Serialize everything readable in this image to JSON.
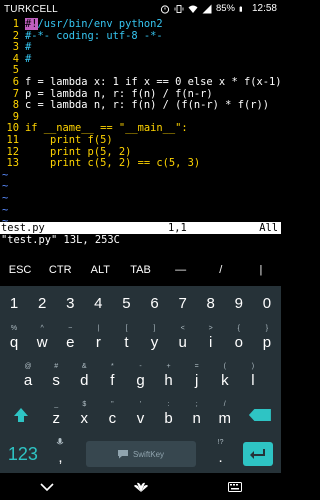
{
  "status": {
    "carrier": "TURKCELL",
    "battery": "85%",
    "time": "12:58"
  },
  "editor": {
    "lines": [
      {
        "n": "1",
        "text": "/usr/bin/env python2"
      },
      {
        "n": "2",
        "text": "#-*- coding: utf-8 -*-"
      },
      {
        "n": "3",
        "text": "#"
      },
      {
        "n": "4",
        "text": "#"
      },
      {
        "n": "5",
        "text": ""
      },
      {
        "n": "6",
        "text": "f = lambda x: 1 if x == 0 else x * f(x-1)"
      },
      {
        "n": "7",
        "text": "p = lambda n, r: f(n) / f(n-r)"
      },
      {
        "n": "8",
        "text": "c = lambda n, r: f(n) / (f(n-r) * f(r))"
      },
      {
        "n": "9",
        "text": ""
      },
      {
        "n": "10",
        "text": "if __name__ == \"__main__\":"
      },
      {
        "n": "11",
        "text": "    print f(5)"
      },
      {
        "n": "12",
        "text": "    print p(5, 2)"
      },
      {
        "n": "13",
        "text": "    print c(5, 2) == c(5, 3)"
      }
    ],
    "tilde_count": 6
  },
  "modeline": {
    "filename": "test.py",
    "position": "1,1",
    "scope": "All"
  },
  "cmdline": "\"test.py\" 13L, 253C",
  "extra_keys": [
    "ESC",
    "CTR",
    "ALT",
    "TAB",
    "—",
    "/",
    "|"
  ],
  "keyboard": {
    "numbers": [
      "1",
      "2",
      "3",
      "4",
      "5",
      "6",
      "7",
      "8",
      "9",
      "0"
    ],
    "row1": [
      {
        "sub": "%",
        "key": "q"
      },
      {
        "sub": "^",
        "key": "w"
      },
      {
        "sub": "~",
        "key": "e"
      },
      {
        "sub": "|",
        "key": "r"
      },
      {
        "sub": "[",
        "key": "t"
      },
      {
        "sub": "]",
        "key": "y"
      },
      {
        "sub": "<",
        "key": "u"
      },
      {
        "sub": ">",
        "key": "i"
      },
      {
        "sub": "{",
        "key": "o"
      },
      {
        "sub": "}",
        "key": "p"
      }
    ],
    "row2": [
      {
        "sub": "@",
        "key": "a"
      },
      {
        "sub": "#",
        "key": "s"
      },
      {
        "sub": "&",
        "key": "d"
      },
      {
        "sub": "*",
        "key": "f"
      },
      {
        "sub": "-",
        "key": "g"
      },
      {
        "sub": "+",
        "key": "h"
      },
      {
        "sub": "=",
        "key": "j"
      },
      {
        "sub": "(",
        "key": "k"
      },
      {
        "sub": ")",
        "key": "l"
      }
    ],
    "row3": [
      {
        "sub": "_",
        "key": "z"
      },
      {
        "sub": "$",
        "key": "x"
      },
      {
        "sub": "\"",
        "key": "c"
      },
      {
        "sub": "'",
        "key": "v"
      },
      {
        "sub": ":",
        "key": "b"
      },
      {
        "sub": ";",
        "key": "n"
      },
      {
        "sub": "/",
        "key": "m"
      }
    ],
    "mode_label": "123",
    "comma": ",",
    "comma_sub": "",
    "period": ".",
    "period_sub": "!?",
    "space_brand": "SwiftKey"
  }
}
